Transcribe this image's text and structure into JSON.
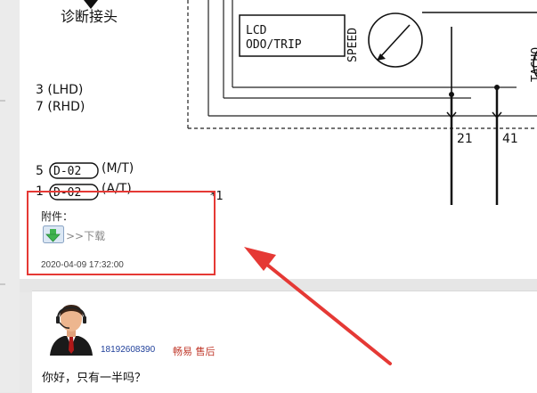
{
  "diagram": {
    "caption_cn": "诊断接头",
    "lhd": "3 (LHD)",
    "rhd": "7 (RHD)",
    "mt_pin": "5",
    "at_pin": "1",
    "connector_a": "D-02",
    "connector_b": "D-02",
    "mt": "(M/T)",
    "at": "(A/T)",
    "note": "*1",
    "lcd_line1": "LCD",
    "lcd_line2": "ODO/TRIP",
    "speed": "SPEED",
    "tacho": "TACHO",
    "wire_21": "21",
    "wire_41": "41"
  },
  "attachment": {
    "label": "附件：",
    "download_text": ">>下载",
    "icon": "download-arrow-icon"
  },
  "post1": {
    "date": "2020-04-09 17:32:00"
  },
  "reply": {
    "username": "18192608390",
    "role": "畅易 售后",
    "text": "你好，只有一半吗？"
  },
  "colors": {
    "highlight": "#e53935",
    "username": "#1f3f9a",
    "role": "#c0392b"
  }
}
